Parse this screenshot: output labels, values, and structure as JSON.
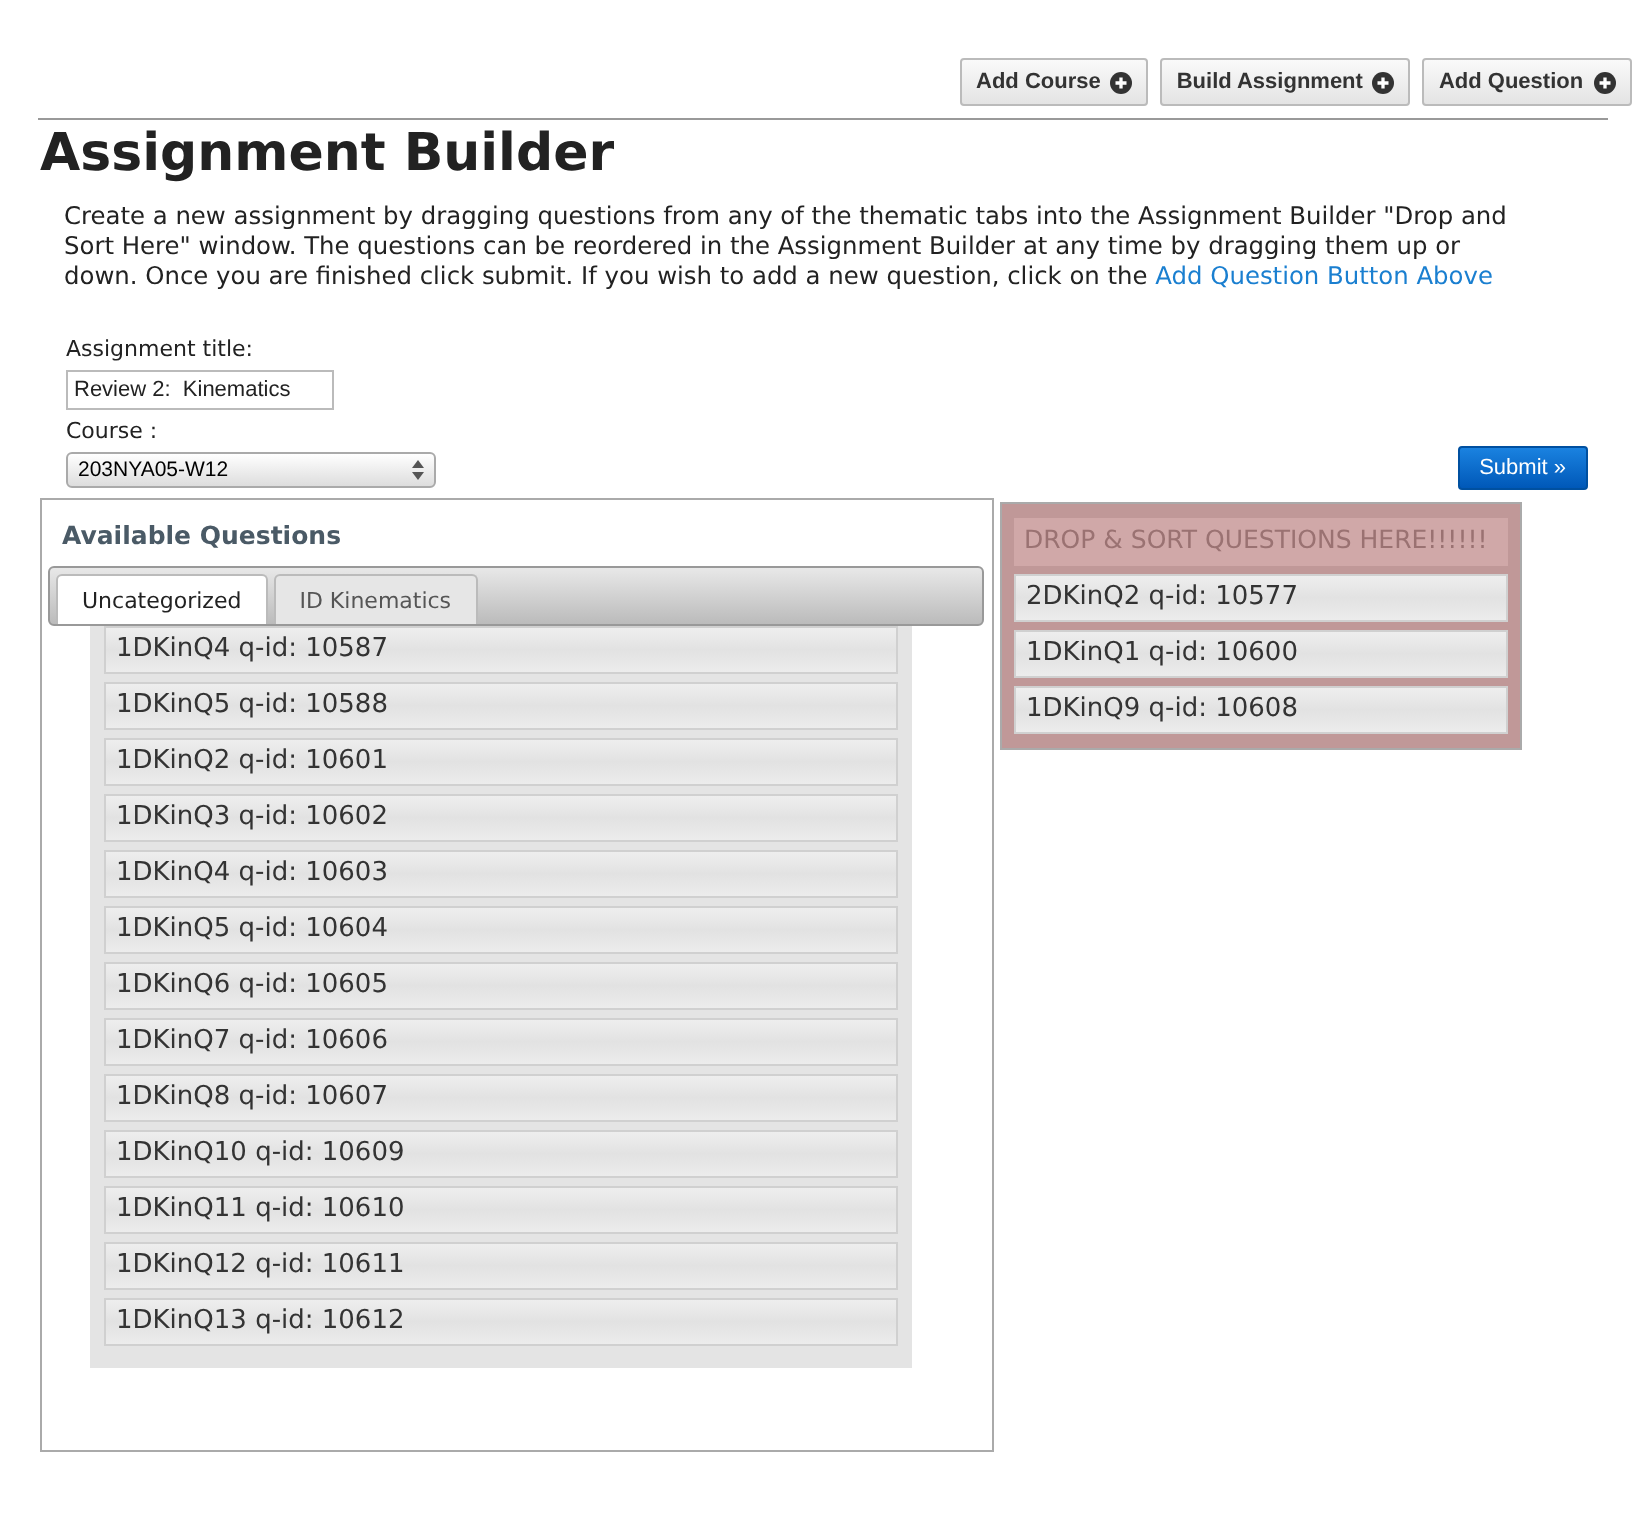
{
  "toolbar": [
    "Add Course",
    "Build Assignment",
    "Add Question"
  ],
  "title": "Assignment Builder",
  "intro": {
    "text": "Create a new assignment by dragging questions from any of the thematic tabs into the Assignment Builder \"Drop and Sort Here\" window. The questions can be reordered in the Assignment Builder at any time by dragging them up or down. Once you are finished click submit. If you wish to add a new question, click on the",
    "link": "Add Question Button Above"
  },
  "form": {
    "title_label": "Assignment title:",
    "title_value": "Review 2:  Kinematics",
    "course_label": "Course :",
    "course_value": "203NYA05-W12",
    "submit": "Submit »"
  },
  "available": {
    "heading": "Available Questions",
    "tabs": [
      {
        "label": "Uncategorized",
        "selected": true
      },
      {
        "label": "ID Kinematics",
        "selected": false
      }
    ],
    "questions": [
      "1DKinQ4 q-id: 10587",
      "1DKinQ5 q-id: 10588",
      "1DKinQ2 q-id: 10601",
      "1DKinQ3 q-id: 10602",
      "1DKinQ4 q-id: 10603",
      "1DKinQ5 q-id: 10604",
      "1DKinQ6 q-id: 10605",
      "1DKinQ7 q-id: 10606",
      "1DKinQ8 q-id: 10607",
      "1DKinQ10 q-id: 10609",
      "1DKinQ11 q-id: 10610",
      "1DKinQ12 q-id: 10611",
      "1DKinQ13 q-id: 10612"
    ]
  },
  "drop": {
    "placeholder": "DROP & SORT QUESTIONS HERE!!!!!!",
    "questions": [
      "2DKinQ2 q-id: 10577",
      "1DKinQ1 q-id: 10600",
      "1DKinQ9 q-id: 10608"
    ]
  }
}
